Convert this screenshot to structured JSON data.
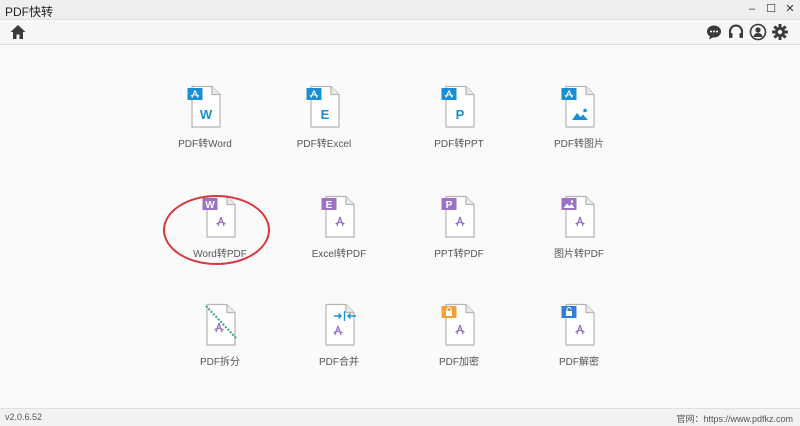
{
  "window": {
    "title": "PDF快转",
    "controls": [
      "–",
      "☐",
      "✕"
    ]
  },
  "toolbar": {
    "home_icon": "home-icon",
    "right_icons": [
      "chat-icon",
      "headset-icon",
      "user-icon",
      "gear-icon"
    ]
  },
  "colors": {
    "pdf": "#1a8fd6",
    "word": "#9b72c4",
    "split": "#3aa37a",
    "merge": "#1a8fd6",
    "lock": "#f0a236",
    "unlock": "#2f7ed8",
    "highlight": "#d9363e"
  },
  "tiles": [
    {
      "label": "PDF转Word",
      "letter": "W"
    },
    {
      "label": "PDF转Excel",
      "letter": "E"
    },
    {
      "label": "PDF转PPT",
      "letter": "P"
    },
    {
      "label": "PDF转图片",
      "icon": "image-icon"
    },
    {
      "label": "Word转PDF",
      "letter": "W"
    },
    {
      "label": "Excel转PDF",
      "letter": "E"
    },
    {
      "label": "PPT转PDF",
      "letter": "P"
    },
    {
      "label": "图片转PDF",
      "icon": "image-icon"
    },
    {
      "label": "PDF拆分",
      "icon": "scissors-icon"
    },
    {
      "label": "PDF合并",
      "icon": "merge-arrows-icon"
    },
    {
      "label": "PDF加密",
      "icon": "lock-icon"
    },
    {
      "label": "PDF解密",
      "icon": "unlock-icon"
    }
  ],
  "status": {
    "version": "v2.0.6.52",
    "website": "官网：https://www.pdfkz.com"
  }
}
